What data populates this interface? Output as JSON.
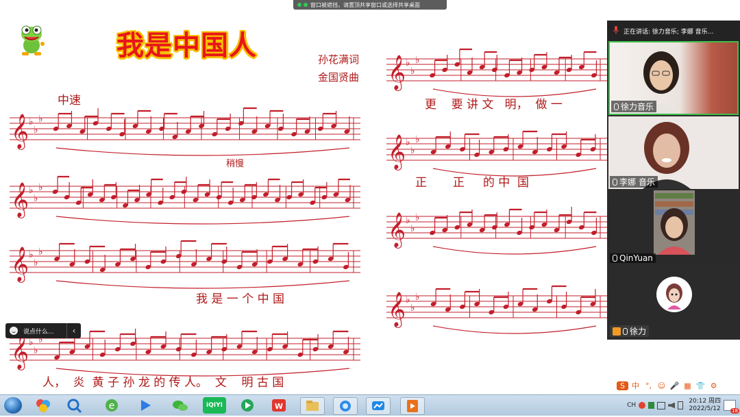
{
  "share_banner": {
    "text": "窗口被遮挡，请置顶共享窗口或选择共享桌面"
  },
  "sheet": {
    "title": "我是中国人",
    "lyricist": "孙花满词",
    "composer": "金国贤曲",
    "tempo": "中速",
    "tempo_change": "稍慢",
    "lyrics_row3": "我 是 一 个 中 国",
    "lyrics_row4": "人，  炎  黄 子 孙 龙 的 传 人。  文    明 古 国",
    "lyrics_right1": "更    要 讲 文   明，  做 一",
    "lyrics_right2": "正       正     的 中  国"
  },
  "chat": {
    "placeholder": "说点什么...",
    "collapse_glyph": "‹"
  },
  "meeting": {
    "speaking_text": "正在讲话: 徐力音乐; 李娜  音乐...",
    "participants": [
      {
        "name": "徐力音乐"
      },
      {
        "name": "李娜  音乐"
      },
      {
        "name": "QinYuan"
      },
      {
        "name": "徐力"
      }
    ]
  },
  "taskbar": {
    "apps": [
      "start-orb",
      "color-balls",
      "search-magnifier",
      "ie-browser",
      "feishu",
      "wechat",
      "iqiyi",
      "media-player",
      "wps",
      "file-explorer",
      "tencent-meeting",
      "chat-app",
      "presentation"
    ],
    "iqiyi_label": "iQIYI",
    "lang": "CH",
    "time": "20:12 周四",
    "date": "2022/5/12",
    "badge": "18"
  },
  "ime_bar": {
    "items": [
      "S",
      "中",
      "°,",
      "☺",
      "🎤",
      "▦",
      "👕",
      "⚙"
    ]
  }
}
